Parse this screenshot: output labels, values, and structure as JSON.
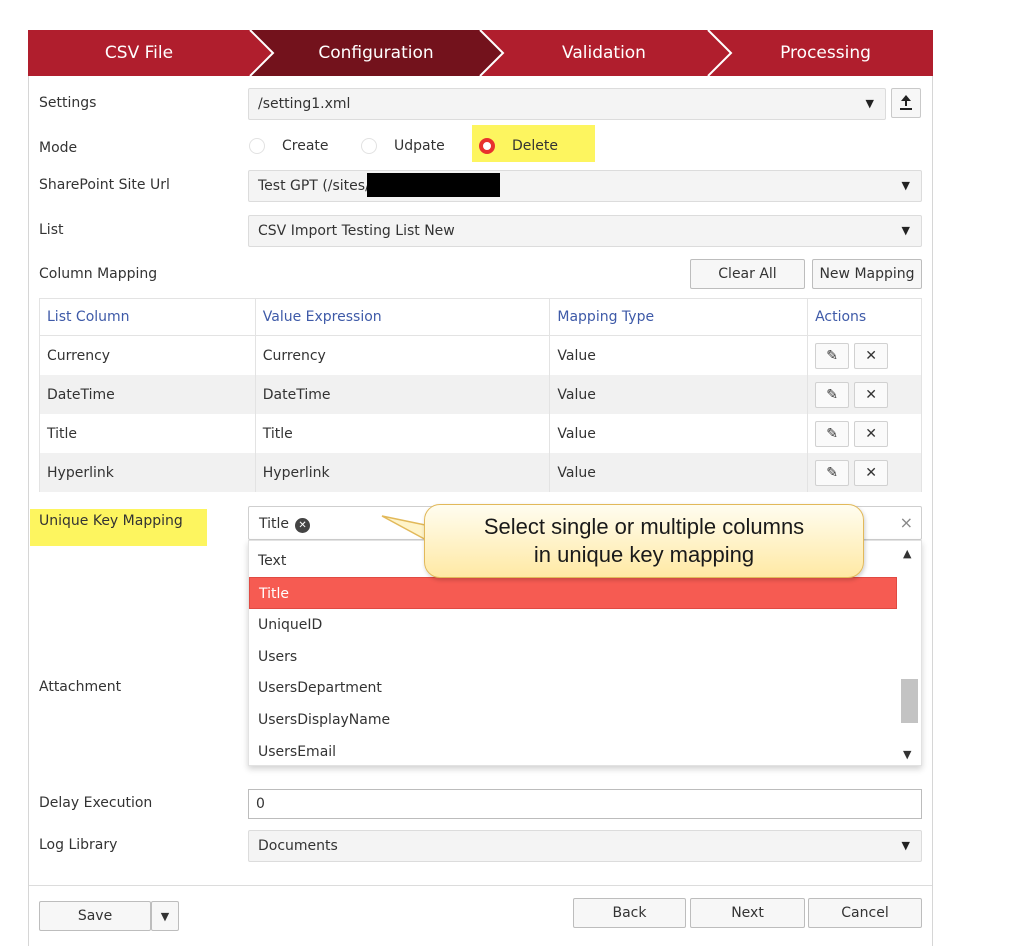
{
  "wizard": {
    "steps": [
      "CSV File",
      "Configuration",
      "Validation",
      "Processing"
    ],
    "active_step": "Configuration",
    "colors": {
      "base": "#b01e2d",
      "active": "#73121c",
      "separator": "#ffffff"
    }
  },
  "settings": {
    "label": "Settings",
    "value": "/setting1.xml"
  },
  "mode": {
    "label": "Mode",
    "options": [
      "Create",
      "Udpate",
      "Delete"
    ],
    "selected": "Delete"
  },
  "site_url": {
    "label": "SharePoint Site Url",
    "value": "Test GPT (/sites/"
  },
  "list": {
    "label": "List",
    "value": "CSV Import Testing List New"
  },
  "column_mapping": {
    "label": "Column Mapping",
    "clear_all_label": "Clear All",
    "new_mapping_label": "New Mapping",
    "headers": [
      "List Column",
      "Value Expression",
      "Mapping Type",
      "Actions"
    ],
    "rows": [
      {
        "list_column": "Currency",
        "value_expression": "Currency",
        "mapping_type": "Value"
      },
      {
        "list_column": "DateTime",
        "value_expression": "DateTime",
        "mapping_type": "Value"
      },
      {
        "list_column": "Title",
        "value_expression": "Title",
        "mapping_type": "Value"
      },
      {
        "list_column": "Hyperlink",
        "value_expression": "Hyperlink",
        "mapping_type": "Value"
      }
    ],
    "edit_icon_glyph": "✎",
    "delete_icon_glyph": "✕"
  },
  "unique_key_mapping": {
    "label": "Unique Key Mapping",
    "selected_tag": "Title",
    "tag_remove_glyph": "✕",
    "clear_glyph": "×",
    "options": [
      "Text",
      "Title",
      "UniqueID",
      "Users",
      "UsersDepartment",
      "UsersDisplayName",
      "UsersEmail"
    ],
    "highlighted_option": "Title",
    "scroll_fraction": 0.72
  },
  "callout": {
    "line1": "Select single or multiple columns",
    "line2": "in unique key mapping"
  },
  "attachment": {
    "label": "Attachment"
  },
  "delay_execution": {
    "label": "Delay Execution",
    "value": "0"
  },
  "log_library": {
    "label": "Log Library",
    "value": "Documents"
  },
  "footer": {
    "save_label": "Save",
    "back_label": "Back",
    "next_label": "Next",
    "cancel_label": "Cancel"
  },
  "highlight_color": "#fdf55f"
}
